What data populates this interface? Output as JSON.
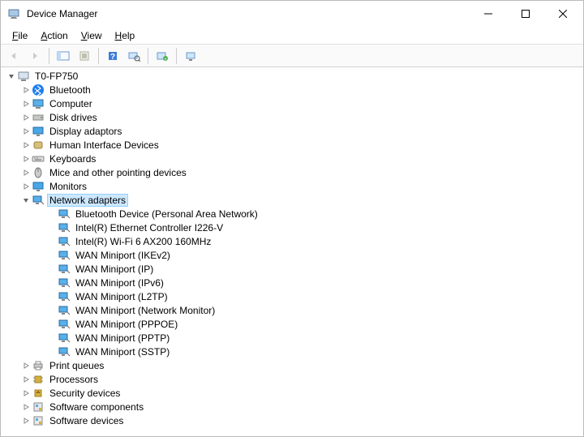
{
  "title": "Device Manager",
  "menus": {
    "file": "File",
    "action": "Action",
    "view": "View",
    "help": "Help"
  },
  "root": "T0-FP750",
  "categories": [
    {
      "label": "Bluetooth",
      "icon": "bluetooth",
      "state": "collapsed"
    },
    {
      "label": "Computer",
      "icon": "computer",
      "state": "collapsed"
    },
    {
      "label": "Disk drives",
      "icon": "disk",
      "state": "collapsed"
    },
    {
      "label": "Display adaptors",
      "icon": "display",
      "state": "collapsed"
    },
    {
      "label": "Human Interface Devices",
      "icon": "hid",
      "state": "collapsed"
    },
    {
      "label": "Keyboards",
      "icon": "keyboard",
      "state": "collapsed"
    },
    {
      "label": "Mice and other pointing devices",
      "icon": "mouse",
      "state": "collapsed"
    },
    {
      "label": "Monitors",
      "icon": "monitor",
      "state": "collapsed"
    },
    {
      "label": "Network adapters",
      "icon": "network",
      "state": "expanded",
      "selected": true,
      "children": [
        "Bluetooth Device (Personal Area Network)",
        "Intel(R) Ethernet Controller I226-V",
        "Intel(R) Wi-Fi 6 AX200 160MHz",
        "WAN Miniport (IKEv2)",
        "WAN Miniport (IP)",
        "WAN Miniport (IPv6)",
        "WAN Miniport (L2TP)",
        "WAN Miniport (Network Monitor)",
        "WAN Miniport (PPPOE)",
        "WAN Miniport (PPTP)",
        "WAN Miniport (SSTP)"
      ]
    },
    {
      "label": "Print queues",
      "icon": "printer",
      "state": "collapsed"
    },
    {
      "label": "Processors",
      "icon": "cpu",
      "state": "collapsed"
    },
    {
      "label": "Security devices",
      "icon": "security",
      "state": "collapsed"
    },
    {
      "label": "Software components",
      "icon": "software",
      "state": "collapsed"
    },
    {
      "label": "Software devices",
      "icon": "software",
      "state": "collapsed"
    }
  ]
}
